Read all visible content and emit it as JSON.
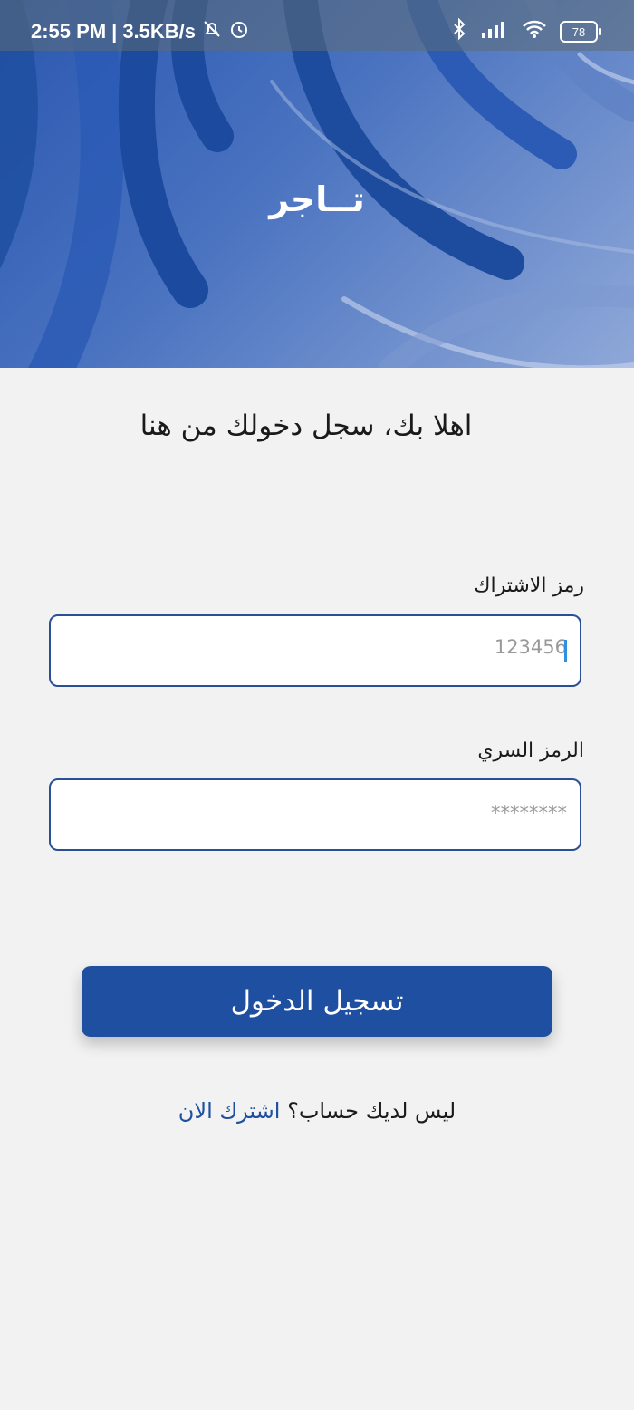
{
  "status_bar": {
    "time": "2:55 PM",
    "separator": "|",
    "net_speed": "3.5KB/s",
    "battery": "78"
  },
  "header": {
    "brand": "تــاجر"
  },
  "welcome_text": "اهلا بك، سجل دخولك من هنا",
  "form": {
    "subscription_label": "رمز الاشتراك",
    "subscription_placeholder": "123456",
    "password_label": "الرمز السري",
    "password_placeholder": "********"
  },
  "login_button": "تسجيل الدخول",
  "signup": {
    "prompt": "ليس لديك حساب؟",
    "link": "اشترك الان"
  },
  "colors": {
    "primary": "#1f4fa0",
    "background": "#f2f2f2",
    "field_border": "#2a4f96"
  }
}
